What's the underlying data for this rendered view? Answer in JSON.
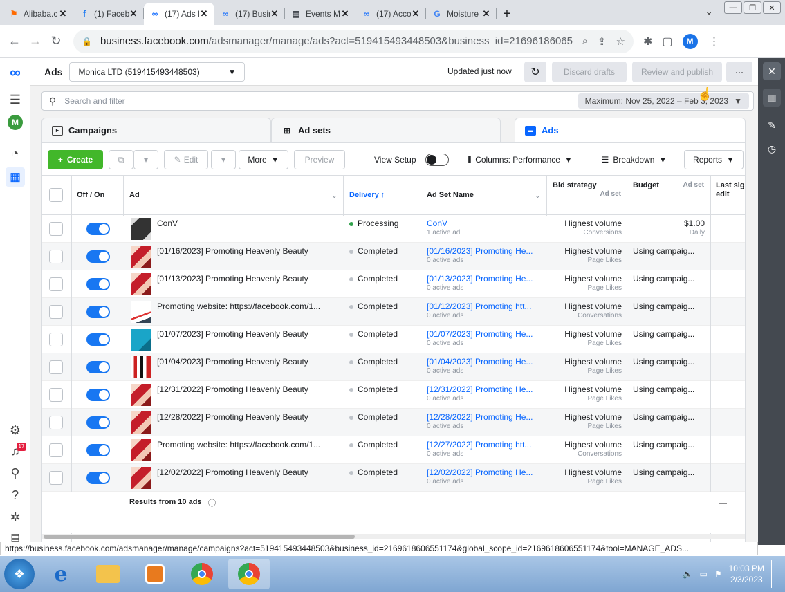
{
  "browser": {
    "tabs": [
      {
        "label": "Alibaba.c",
        "icon": "alibaba-icon",
        "color": "#ff6a00",
        "active": false
      },
      {
        "label": "(1) Faceb",
        "icon": "facebook-icon",
        "color": "#1877f2",
        "active": false
      },
      {
        "label": "(17) Ads I",
        "icon": "meta-icon",
        "color": "#0866ff",
        "active": true
      },
      {
        "label": "(17) Busir",
        "icon": "meta-icon",
        "color": "#0866ff",
        "active": false
      },
      {
        "label": "Events M",
        "icon": "events-icon",
        "color": "#444950",
        "active": false
      },
      {
        "label": "(17) Acco",
        "icon": "meta-icon",
        "color": "#0866ff",
        "active": false
      },
      {
        "label": "Moisture",
        "icon": "google-icon",
        "color": "#4285f4",
        "active": false
      }
    ],
    "url_host": "business.facebook.com",
    "url_path": "/adsmanager/manage/ads?act=519415493448503&business_id=21696186065...",
    "profile_initial": "M"
  },
  "rail": {
    "account_initial": "M",
    "notification_count": "17"
  },
  "header": {
    "title": "Ads",
    "account": "Monica LTD (519415493448503)",
    "updated": "Updated just now",
    "discard": "Discard drafts",
    "review": "Review and publish",
    "more": "···"
  },
  "search": {
    "placeholder": "Search and filter",
    "date_range": "Maximum: Nov 25, 2022 – Feb 3, 2023"
  },
  "levels": {
    "campaigns": "Campaigns",
    "adsets": "Ad sets",
    "ads": "Ads"
  },
  "toolbar": {
    "create": "Create",
    "edit": "Edit",
    "more": "More",
    "preview": "Preview",
    "view_setup": "View Setup",
    "columns": "Columns: Performance",
    "breakdown": "Breakdown",
    "reports": "Reports"
  },
  "table": {
    "headers": {
      "onoff": "Off / On",
      "ad": "Ad",
      "delivery": "Delivery ↑",
      "adset": "Ad Set Name",
      "bid": "Bid strategy",
      "bid_sub": "Ad set",
      "budget": "Budget",
      "budget_sub": "Ad set",
      "lastedit": "Last sig edit"
    },
    "rows": [
      {
        "ad": "ConV",
        "delivery": "Processing",
        "status": "green",
        "adset": "ConV",
        "adset_sub": "1 active ad",
        "bid": "Highest volume",
        "bid_sub": "Conversions",
        "budget": "$1.00",
        "budget_sub": "Daily",
        "thumb": "dark"
      },
      {
        "ad": "[01/16/2023] Promoting Heavenly Beauty",
        "delivery": "Completed",
        "status": "gray",
        "adset": "[01/16/2023] Promoting He...",
        "adset_sub": "0 active ads",
        "bid": "Highest volume",
        "bid_sub": "Page Likes",
        "budget": "Using campaig...",
        "budget_sub": "",
        "thumb": "red"
      },
      {
        "ad": "[01/13/2023] Promoting Heavenly Beauty",
        "delivery": "Completed",
        "status": "gray",
        "adset": "[01/13/2023] Promoting He...",
        "adset_sub": "0 active ads",
        "bid": "Highest volume",
        "bid_sub": "Page Likes",
        "budget": "Using campaig...",
        "budget_sub": "",
        "thumb": "red"
      },
      {
        "ad": "Promoting website: https://facebook.com/1...",
        "delivery": "Completed",
        "status": "gray",
        "adset": "[01/12/2023] Promoting htt...",
        "adset_sub": "0 active ads",
        "bid": "Highest volume",
        "bid_sub": "Conversations",
        "budget": "Using campaig...",
        "budget_sub": "",
        "thumb": "white"
      },
      {
        "ad": "[01/07/2023] Promoting Heavenly Beauty",
        "delivery": "Completed",
        "status": "gray",
        "adset": "[01/07/2023] Promoting He...",
        "adset_sub": "0 active ads",
        "bid": "Highest volume",
        "bid_sub": "Page Likes",
        "budget": "Using campaig...",
        "budget_sub": "",
        "thumb": "blue"
      },
      {
        "ad": "[01/04/2023] Promoting Heavenly Beauty",
        "delivery": "Completed",
        "status": "gray",
        "adset": "[01/04/2023] Promoting He...",
        "adset_sub": "0 active ads",
        "bid": "Highest volume",
        "bid_sub": "Page Likes",
        "budget": "Using campaig...",
        "budget_sub": "",
        "thumb": "bottles"
      },
      {
        "ad": "[12/31/2022] Promoting Heavenly Beauty",
        "delivery": "Completed",
        "status": "gray",
        "adset": "[12/31/2022] Promoting He...",
        "adset_sub": "0 active ads",
        "bid": "Highest volume",
        "bid_sub": "Page Likes",
        "budget": "Using campaig...",
        "budget_sub": "",
        "thumb": "red"
      },
      {
        "ad": "[12/28/2022] Promoting Heavenly Beauty",
        "delivery": "Completed",
        "status": "gray",
        "adset": "[12/28/2022] Promoting He...",
        "adset_sub": "0 active ads",
        "bid": "Highest volume",
        "bid_sub": "Page Likes",
        "budget": "Using campaig...",
        "budget_sub": "",
        "thumb": "red"
      },
      {
        "ad": "Promoting website: https://facebook.com/1...",
        "delivery": "Completed",
        "status": "gray",
        "adset": "[12/27/2022] Promoting htt...",
        "adset_sub": "0 active ads",
        "bid": "Highest volume",
        "bid_sub": "Conversations",
        "budget": "Using campaig...",
        "budget_sub": "",
        "thumb": "red"
      },
      {
        "ad": "[12/02/2022] Promoting Heavenly Beauty",
        "delivery": "Completed",
        "status": "gray",
        "adset": "[12/02/2022] Promoting He...",
        "adset_sub": "0 active ads",
        "bid": "Highest volume",
        "bid_sub": "Page Likes",
        "budget": "Using campaig...",
        "budget_sub": "",
        "thumb": "red"
      }
    ],
    "results": "Results from 10 ads",
    "last_edit_total": "—"
  },
  "status_url": "https://business.facebook.com/adsmanager/manage/campaigns?act=519415493448503&business_id=2169618606551174&global_scope_id=2169618606551174&tool=MANAGE_ADS...",
  "taskbar": {
    "time": "10:03 PM",
    "date": "2/3/2023"
  }
}
